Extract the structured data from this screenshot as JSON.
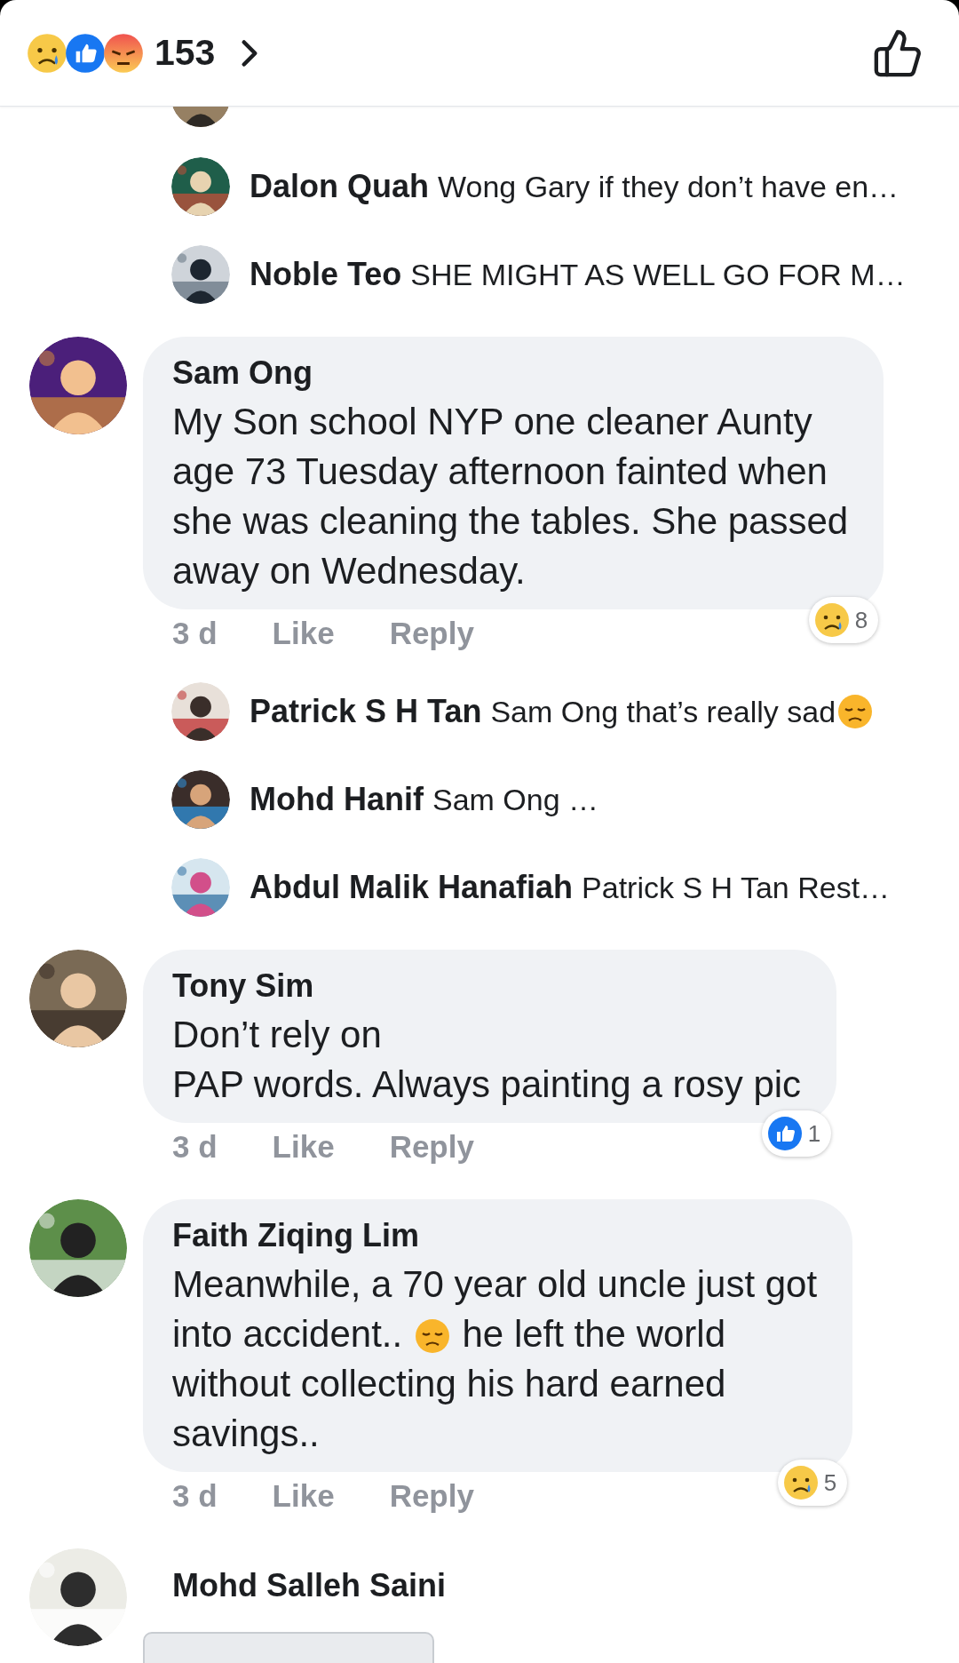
{
  "header": {
    "reactions": [
      {
        "kind": "sad"
      },
      {
        "kind": "like"
      },
      {
        "kind": "angry"
      }
    ],
    "count": "153"
  },
  "items": [
    {
      "kind": "clipped_reply"
    },
    {
      "kind": "reply",
      "name": "Dalon Quah",
      "body": [
        {
          "kind": "text",
          "text": "Wong Gary if they don’t have en…"
        }
      ]
    },
    {
      "kind": "reply",
      "name": "Noble Teo",
      "body": [
        {
          "kind": "text",
          "text": "SHE  MIGHT AS WELL GO FOR M…"
        }
      ]
    },
    {
      "kind": "comment",
      "name": "Sam Ong",
      "body": [
        {
          "kind": "text",
          "text": "My Son school NYP one cleaner Aunty\nage 73 Tuesday afternoon fainted when\nshe was cleaning the tables. She passed\naway on Wednesday."
        }
      ],
      "time": "3 d",
      "actions": [
        "Like",
        "Reply"
      ],
      "reaction": {
        "kind": "sad",
        "count": "8"
      }
    },
    {
      "kind": "reply",
      "name": "Patrick S H Tan",
      "body": [
        {
          "kind": "text",
          "text": "Sam Ong that’s really sad"
        },
        {
          "kind": "emoji"
        }
      ]
    },
    {
      "kind": "reply",
      "name": "Mohd Hanif",
      "body": [
        {
          "kind": "text",
          "text": "Sam Ong …"
        }
      ]
    },
    {
      "kind": "reply",
      "name": "Abdul Malik Hanafiah",
      "body": [
        {
          "kind": "text",
          "text": "Patrick S H Tan  Rest…"
        }
      ]
    },
    {
      "kind": "comment",
      "name": "Tony Sim",
      "body": [
        {
          "kind": "text",
          "text": "Don’t rely on\nPAP words. Always painting a rosy pic"
        }
      ],
      "time": "3 d",
      "actions": [
        "Like",
        "Reply"
      ],
      "reaction": {
        "kind": "like",
        "count": "1"
      }
    },
    {
      "kind": "comment",
      "name": "Faith Ziqing Lim",
      "body": [
        {
          "kind": "text",
          "text": "Meanwhile, a 70 year old uncle just got\ninto accident.. "
        },
        {
          "kind": "emoji"
        },
        {
          "kind": "text",
          "text": " he left the world\nwithout collecting his hard earned\nsavings.."
        }
      ],
      "time": "3 d",
      "actions": [
        "Like",
        "Reply"
      ],
      "reaction": {
        "kind": "sad",
        "count": "5"
      }
    },
    {
      "kind": "comment",
      "name": "Mohd Salleh Saini",
      "attachment": true
    }
  ]
}
